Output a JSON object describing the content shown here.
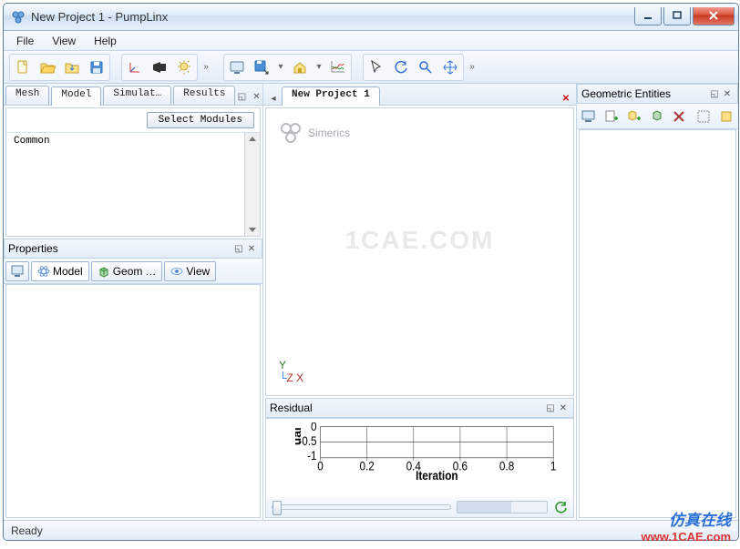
{
  "window": {
    "title": "New Project 1 - PumpLinx"
  },
  "menu": {
    "file": "File",
    "view": "View",
    "help": "Help"
  },
  "left_tabs": {
    "mesh": "Mesh",
    "model": "Model",
    "simulation": "Simulat",
    "results": "Results"
  },
  "modules": {
    "select_button": "Select Modules",
    "items": [
      "Common"
    ]
  },
  "properties": {
    "title": "Properties",
    "tabs": {
      "model": "Model",
      "geom": "Geom",
      "view": "View"
    }
  },
  "document": {
    "tab_title": "New Project 1",
    "brand": "Simerics",
    "watermark": "1CAE.COM",
    "axis_y": "Y",
    "axis_zx": "Z  X"
  },
  "residual": {
    "title": "Residual"
  },
  "chart_data": {
    "type": "line",
    "title": "",
    "xlabel": "Iteration",
    "ylabel": "ual",
    "x_ticks": [
      0,
      0.2,
      0.4,
      0.6,
      0.8,
      1
    ],
    "y_ticks": [
      0,
      -0.5,
      -1
    ],
    "xlim": [
      0,
      1
    ],
    "ylim": [
      -1,
      0
    ],
    "series": []
  },
  "geometry": {
    "title": "Geometric Entities"
  },
  "status": {
    "text": "Ready"
  },
  "site_watermark": {
    "cn": "仿真在线",
    "url": "www.1CAE.com"
  },
  "colors": {
    "accent": "#2f6fb5",
    "close": "#c83a24",
    "axis": "#2a7a2a"
  }
}
